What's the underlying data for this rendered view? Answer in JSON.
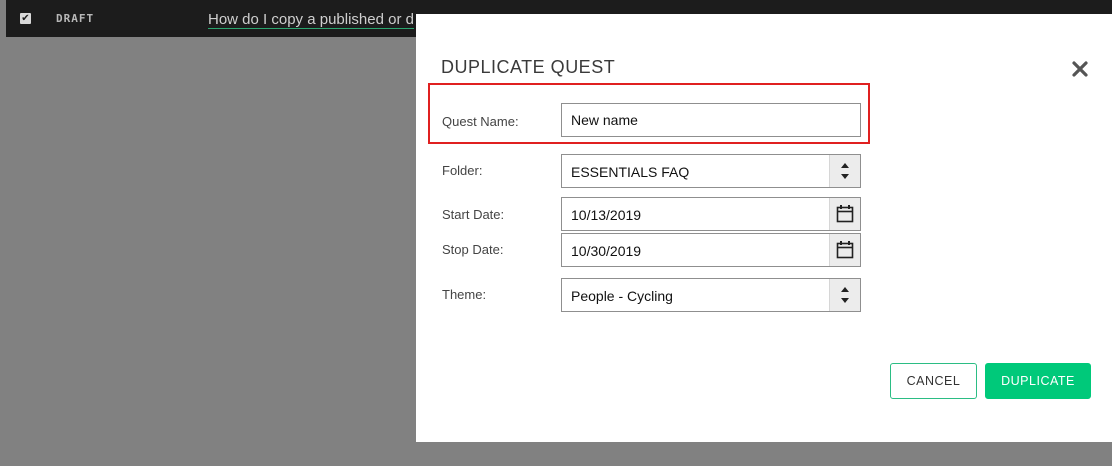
{
  "background": {
    "row_status": "DRAFT",
    "row_title": "How do I copy a published or d"
  },
  "modal": {
    "title": "DUPLICATE QUEST",
    "fields": {
      "quest_name": {
        "label": "Quest Name:",
        "value": "New name"
      },
      "folder": {
        "label": "Folder:",
        "value": "ESSENTIALS FAQ"
      },
      "start_date": {
        "label": "Start Date:",
        "value": "10/13/2019"
      },
      "stop_date": {
        "label": "Stop Date:",
        "value": "10/30/2019"
      },
      "theme": {
        "label": "Theme:",
        "value": "People - Cycling"
      }
    },
    "buttons": {
      "cancel": "CANCEL",
      "duplicate": "DUPLICATE"
    }
  },
  "colors": {
    "accent": "#00c97a",
    "highlight": "#e02020",
    "overlay": "#818181"
  },
  "icons": [
    "checkbox-icon",
    "close-icon",
    "select-arrows-icon",
    "calendar-icon"
  ]
}
